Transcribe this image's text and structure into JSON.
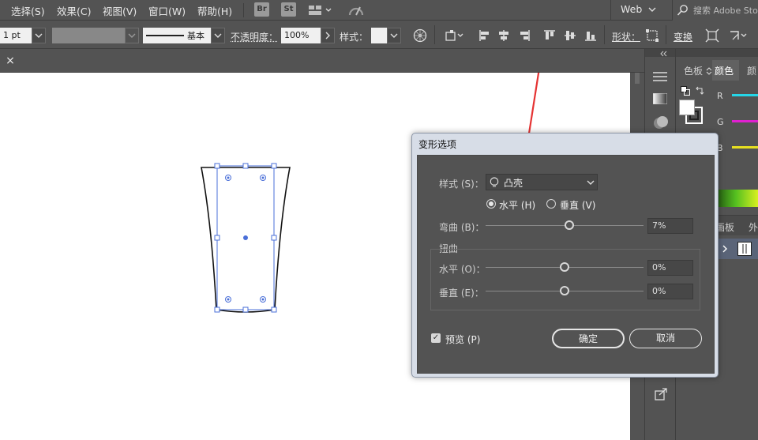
{
  "menubar": {
    "items": [
      "选择(S)",
      "效果(C)",
      "视图(V)",
      "窗口(W)",
      "帮助(H)"
    ],
    "app_buttons": [
      "Br",
      "St"
    ],
    "workspace": "Web",
    "search_placeholder": "搜索 Adobe Stock"
  },
  "controlbar": {
    "stroke_weight": "1 pt",
    "brush_label": "基本",
    "opacity_label": "不透明度：",
    "opacity_value": "100%",
    "style_label": "样式：",
    "shape_label": "形状：",
    "transform_label": "变换"
  },
  "tab": {
    "close_symbol": "×"
  },
  "panel": {
    "tabs": [
      "色板",
      "颜色",
      "颜"
    ],
    "channels": [
      {
        "name": "R",
        "color": "#25d6e8"
      },
      {
        "name": "G",
        "color": "#e020d0"
      },
      {
        "name": "B",
        "color": "#e8e020"
      }
    ],
    "lower_tabs": [
      "画板",
      "外"
    ]
  },
  "dialog": {
    "title": "变形选项",
    "style_label": "样式 (S)：",
    "style_value": "凸壳",
    "orientation": [
      {
        "label": "水平 (H)",
        "selected": true
      },
      {
        "label": "垂直 (V)",
        "selected": false
      }
    ],
    "bend_label": "弯曲 (B)：",
    "bend_value": "7%",
    "bend_pos": 0.53,
    "distortion_title": "扭曲",
    "horizontal_label": "水平 (O)：",
    "horizontal_value": "0%",
    "horizontal_pos": 0.5,
    "vertical_label": "垂直 (E)：",
    "vertical_value": "0%",
    "vertical_pos": 0.5,
    "preview_label": "预览 (P)",
    "preview_checked": true,
    "ok_label": "确定",
    "cancel_label": "取消"
  },
  "colors": {
    "dialog_title_bg": "#d7dde7",
    "dialog_body": "#535353",
    "selection": "#4a6fd8",
    "annotation_arrow": "#e53333"
  }
}
